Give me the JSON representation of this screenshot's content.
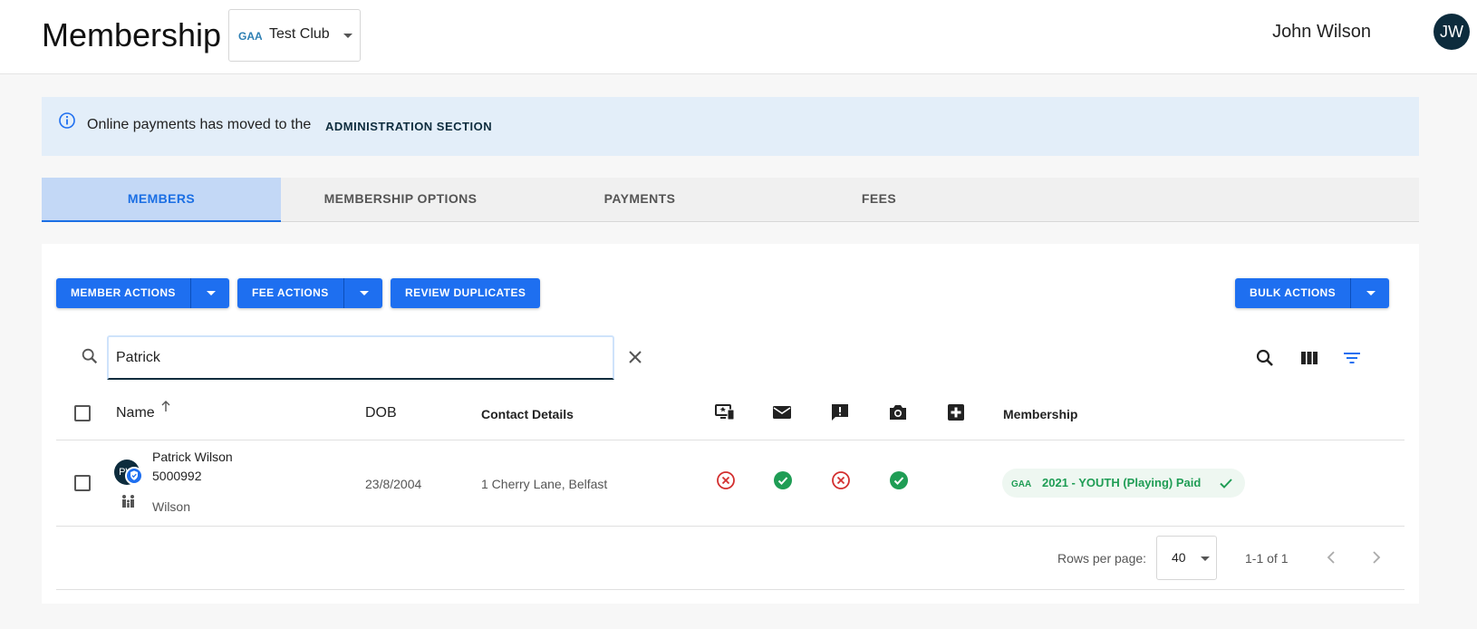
{
  "header": {
    "title": "Membership",
    "club": "Test Club",
    "user_name": "John Wilson",
    "user_initials": "JW"
  },
  "banner": {
    "text": "Online payments has moved to the",
    "link": "ADMINISTRATION SECTION"
  },
  "tabs": [
    {
      "label": "MEMBERS",
      "active": true
    },
    {
      "label": "MEMBERSHIP OPTIONS",
      "active": false
    },
    {
      "label": "PAYMENTS",
      "active": false
    },
    {
      "label": "FEES",
      "active": false
    }
  ],
  "toolbar": {
    "member_actions": "MEMBER ACTIONS",
    "fee_actions": "FEE ACTIONS",
    "review_duplicates": "REVIEW DUPLICATES",
    "bulk_actions": "BULK ACTIONS"
  },
  "search": {
    "value": "Patrick"
  },
  "table": {
    "columns": {
      "name": "Name",
      "dob": "DOB",
      "contact": "Contact Details",
      "membership": "Membership"
    },
    "rows": [
      {
        "initials": "PW",
        "name": "Patrick Wilson",
        "id": "5000992",
        "family": "Wilson",
        "dob": "23/8/2004",
        "contact": "1 Cherry Lane, Belfast",
        "statuses": [
          "no",
          "yes",
          "no",
          "yes"
        ],
        "membership": "2021 - YOUTH (Playing) Paid"
      }
    ]
  },
  "pagination": {
    "rows_label": "Rows per page:",
    "rows_value": "40",
    "range": "1-1 of 1"
  },
  "colors": {
    "primary": "#1e6ff0",
    "dark": "#0d2c3d",
    "success": "#1f9d55",
    "error": "#d32f2f"
  }
}
